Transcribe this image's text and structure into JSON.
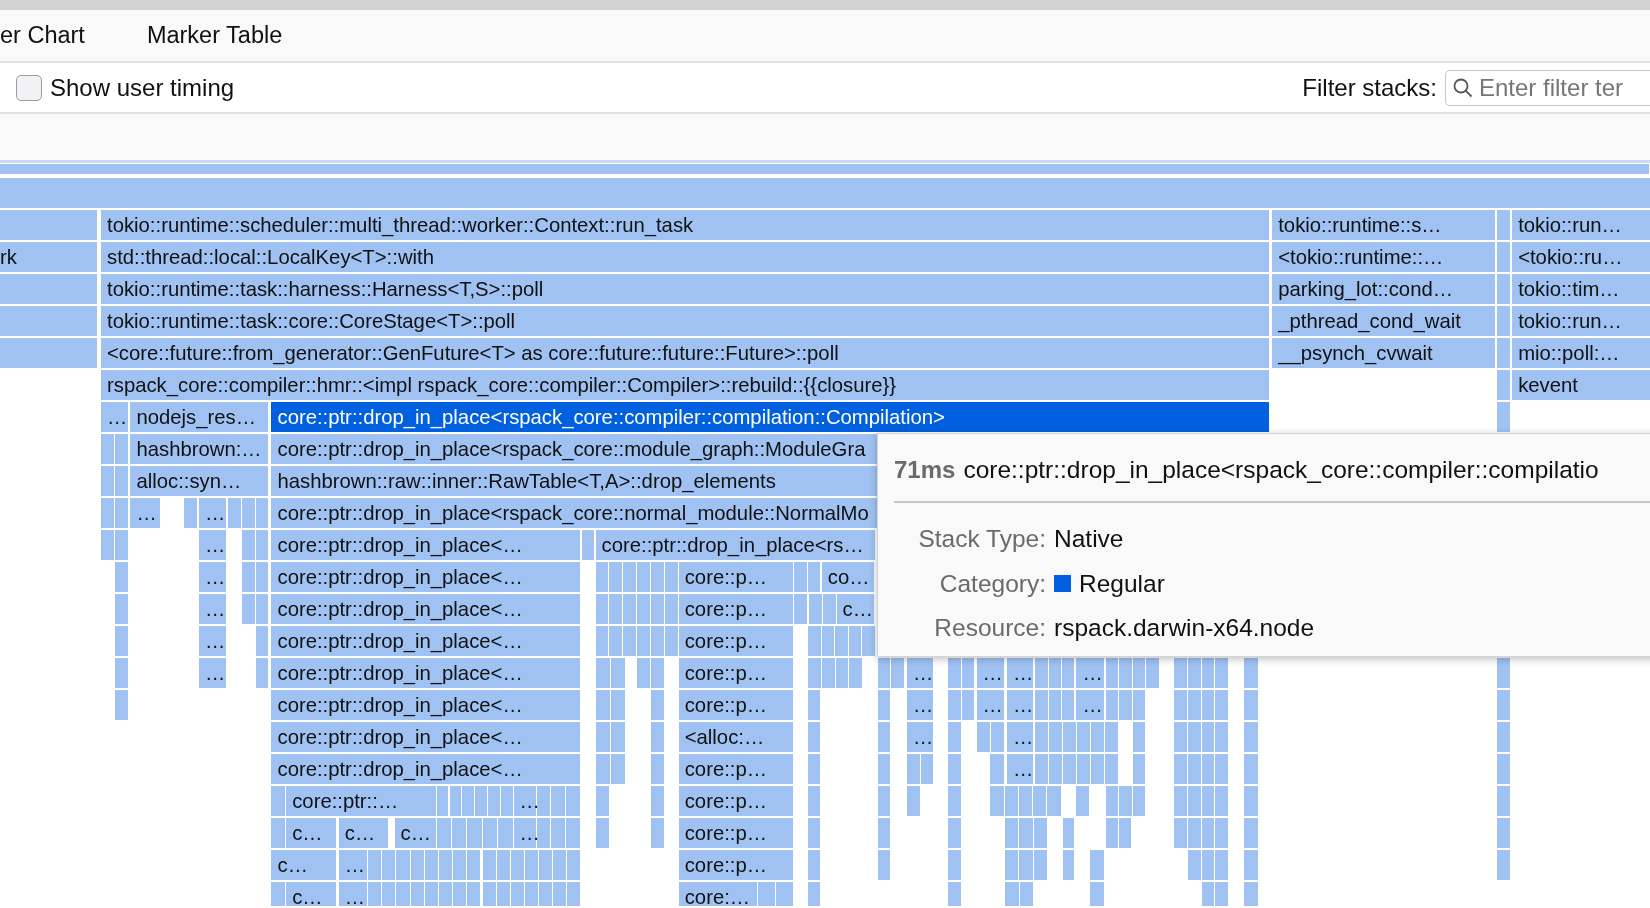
{
  "tabs": [
    {
      "label": "er Chart"
    },
    {
      "label": "Marker Table"
    }
  ],
  "settings": {
    "show_user_timing": {
      "label": "Show user timing",
      "checked": false
    },
    "filter": {
      "label": "Filter stacks:",
      "placeholder": "Enter filter ter"
    }
  },
  "flame_graph": {
    "rows": [
      {
        "frames": [
          {
            "label": "tokio::runtime::scheduler::multi_thread::worker::Context::run_task",
            "selected": false
          },
          {
            "label": "tokio::runtime::s…",
            "selected": false
          },
          {
            "label": "tokio::run…",
            "selected": false
          }
        ]
      },
      {
        "frames": [
          {
            "label": "rk",
            "selected": false
          },
          {
            "label": "std::thread::local::LocalKey<T>::with",
            "selected": false
          },
          {
            "label": "<tokio::runtime::…",
            "selected": false
          },
          {
            "label": "<tokio::ru…",
            "selected": false
          }
        ]
      },
      {
        "frames": [
          {
            "label": "tokio::runtime::task::harness::Harness<T,S>::poll",
            "selected": false
          },
          {
            "label": "parking_lot::cond…",
            "selected": false
          },
          {
            "label": "tokio::tim…",
            "selected": false
          }
        ]
      },
      {
        "frames": [
          {
            "label": "tokio::runtime::task::core::CoreStage<T>::poll",
            "selected": false
          },
          {
            "label": "_pthread_cond_wait",
            "selected": false
          },
          {
            "label": "tokio::run…",
            "selected": false
          }
        ]
      },
      {
        "frames": [
          {
            "label": "<core::future::from_generator::GenFuture<T> as core::future::future::Future>::poll",
            "selected": false
          },
          {
            "label": "__psynch_cvwait",
            "selected": false
          },
          {
            "label": "mio::poll:…",
            "selected": false
          }
        ]
      },
      {
        "frames": [
          {
            "label": "rspack_core::compiler::hmr::<impl rspack_core::compiler::Compiler>::rebuild::{{closure}}",
            "selected": false
          },
          {
            "label": "kevent",
            "selected": false
          }
        ]
      },
      {
        "frames": [
          {
            "label": "…",
            "selected": false
          },
          {
            "label": "nodejs_res…",
            "selected": false
          },
          {
            "label": "core::ptr::drop_in_place<rspack_core::compiler::compilation::Compilation>",
            "selected": true
          }
        ]
      },
      {
        "frames": [
          {
            "label": "hashbrown:…",
            "selected": false
          },
          {
            "label": "core::ptr::drop_in_place<rspack_core::module_graph::ModuleGra",
            "selected": false
          }
        ]
      },
      {
        "frames": [
          {
            "label": "alloc::syn…",
            "selected": false
          },
          {
            "label": "hashbrown::raw::inner::RawTable<T,A>::drop_elements",
            "selected": false
          }
        ]
      },
      {
        "frames": [
          {
            "label": "…",
            "selected": false
          },
          {
            "label": "…",
            "selected": false
          },
          {
            "label": "core::ptr::drop_in_place<rspack_core::normal_module::NormalMo",
            "selected": false
          }
        ]
      },
      {
        "frames": [
          {
            "label": "…",
            "selected": false
          },
          {
            "label": "core::ptr::drop_in_place<…",
            "selected": false
          },
          {
            "label": "core::ptr::drop_in_place<rs…",
            "selected": false
          }
        ]
      },
      {
        "frames": [
          {
            "label": "…",
            "selected": false
          },
          {
            "label": "core::ptr::drop_in_place<…",
            "selected": false
          },
          {
            "label": "core::p…",
            "selected": false
          },
          {
            "label": "co…",
            "selected": false
          }
        ]
      },
      {
        "frames": [
          {
            "label": "…",
            "selected": false
          },
          {
            "label": "core::ptr::drop_in_place<…",
            "selected": false
          },
          {
            "label": "core::p…",
            "selected": false
          },
          {
            "label": "c…",
            "selected": false
          }
        ]
      },
      {
        "frames": [
          {
            "label": "…",
            "selected": false
          },
          {
            "label": "core::ptr::drop_in_place<…",
            "selected": false
          },
          {
            "label": "core::p…",
            "selected": false
          }
        ]
      },
      {
        "frames": [
          {
            "label": "…",
            "selected": false
          },
          {
            "label": "core::ptr::drop_in_place<…",
            "selected": false
          },
          {
            "label": "core::p…",
            "selected": false
          },
          {
            "label": "…",
            "selected": false
          },
          {
            "label": "…",
            "selected": false
          },
          {
            "label": "…",
            "selected": false
          },
          {
            "label": "…",
            "selected": false
          }
        ]
      },
      {
        "frames": [
          {
            "label": "core::ptr::drop_in_place<…",
            "selected": false
          },
          {
            "label": "core::p…",
            "selected": false
          },
          {
            "label": "…",
            "selected": false
          },
          {
            "label": "…",
            "selected": false
          },
          {
            "label": "…",
            "selected": false
          },
          {
            "label": "…",
            "selected": false
          }
        ]
      },
      {
        "frames": [
          {
            "label": "core::ptr::drop_in_place<…",
            "selected": false
          },
          {
            "label": "<alloc:…",
            "selected": false
          },
          {
            "label": "…",
            "selected": false
          },
          {
            "label": "…",
            "selected": false
          }
        ]
      },
      {
        "frames": [
          {
            "label": "core::ptr::drop_in_place<…",
            "selected": false
          },
          {
            "label": "core::p…",
            "selected": false
          },
          {
            "label": "…",
            "selected": false
          }
        ]
      },
      {
        "frames": [
          {
            "label": "core::ptr::…",
            "selected": false
          },
          {
            "label": "…",
            "selected": false
          },
          {
            "label": "core::p…",
            "selected": false
          }
        ]
      },
      {
        "frames": [
          {
            "label": "c…",
            "selected": false
          },
          {
            "label": "c…",
            "selected": false
          },
          {
            "label": "c…",
            "selected": false
          },
          {
            "label": "…",
            "selected": false
          },
          {
            "label": "core::p…",
            "selected": false
          }
        ]
      },
      {
        "frames": [
          {
            "label": "c…",
            "selected": false
          },
          {
            "label": "…",
            "selected": false
          },
          {
            "label": "core::p…",
            "selected": false
          }
        ]
      },
      {
        "frames": [
          {
            "label": "c…",
            "selected": false
          },
          {
            "label": "…",
            "selected": false
          },
          {
            "label": "core:…",
            "selected": false
          }
        ]
      }
    ]
  },
  "tooltip": {
    "duration": "71ms",
    "title": "core::ptr::drop_in_place<rspack_core::compiler::compilatio",
    "fields": [
      {
        "label": "Stack Type:",
        "value": "Native"
      },
      {
        "label": "Category:",
        "value": "Regular",
        "color": "#0060df"
      },
      {
        "label": "Resource:",
        "value": "rspack.darwin-x64.node"
      }
    ]
  }
}
